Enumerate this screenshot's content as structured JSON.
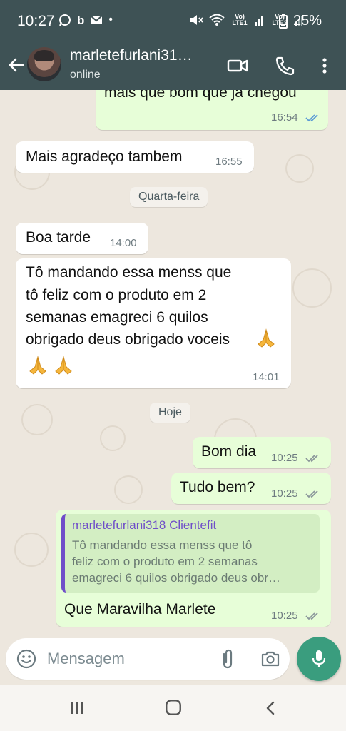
{
  "status_bar": {
    "time": "10:27",
    "battery": "25%",
    "sim1": "Vo) LTE1",
    "sim2": "Vo) LTE2"
  },
  "header": {
    "contact_name": "marletefurlani31…",
    "status": "online"
  },
  "messages": [
    {
      "direction": "out",
      "text": "mais que bom que ja chegou",
      "time": "16:54"
    },
    {
      "direction": "in",
      "text": "Mais agradeço tambem",
      "time": "16:55"
    },
    {
      "type": "date",
      "text": "Quarta-feira"
    },
    {
      "direction": "in",
      "text": "Boa tarde",
      "time": "14:00"
    },
    {
      "direction": "in",
      "lines": [
        "Tô mandando essa menss que",
        "tô feliz com o produto em 2",
        "semanas emagreci 6 quilos",
        "obrigado deus obrigado voceis"
      ],
      "time": "14:01"
    },
    {
      "type": "date",
      "text": "Hoje"
    },
    {
      "direction": "out",
      "text": "Bom dia",
      "time": "10:25"
    },
    {
      "direction": "out",
      "text": "Tudo bem?",
      "time": "10:25"
    },
    {
      "direction": "out",
      "quote_author": "marletefurlani318 Clientefit",
      "quote_lines": [
        "Tô mandando essa menss que tô",
        "feliz com o produto em 2 semanas",
        "emagreci 6 quilos obrigado deus obr…"
      ],
      "text": "Que Maravilha Marlete",
      "time": "10:25"
    }
  ],
  "input": {
    "placeholder": "Mensagem"
  },
  "icons": {
    "back": "arrow-left-icon",
    "video": "video-call-icon",
    "phone": "phone-icon",
    "menu": "more-vert-icon",
    "emoji": "emoji-icon",
    "attach": "paperclip-icon",
    "camera": "camera-icon",
    "mic": "mic-icon"
  },
  "colors": {
    "header": "#3e5255",
    "outgoing_bubble": "#e7fed8",
    "incoming_bubble": "#ffffff",
    "accent": "#3a9d7e",
    "quote_bar": "#6f4ec9",
    "read_ticks": "#5b9bd5"
  }
}
